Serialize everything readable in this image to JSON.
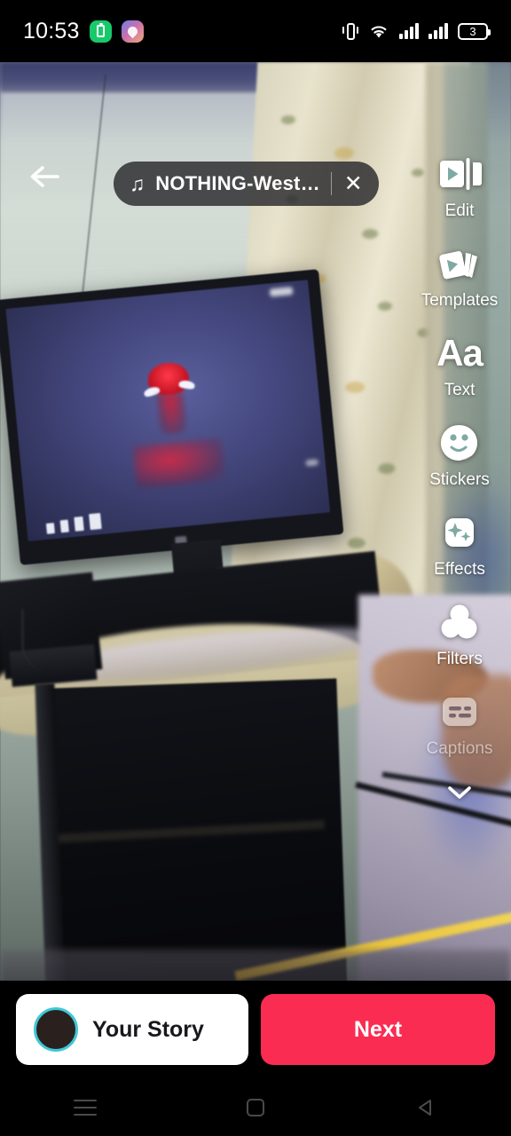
{
  "statusbar": {
    "time": "10:53",
    "battery_level": "3",
    "icons": [
      "battery-saver-icon",
      "app-icon",
      "gmail-icon",
      "vibrate-icon",
      "wifi-icon",
      "signal-icon",
      "signal-icon",
      "battery-icon"
    ]
  },
  "overlay": {
    "back_label": "←",
    "music": {
      "note_icon": "♫",
      "title": "NOTHING-West…",
      "close_label": "✕"
    }
  },
  "tools": [
    {
      "label": "Edit",
      "icon": "edit-icon",
      "enabled": true
    },
    {
      "label": "Templates",
      "icon": "templates-icon",
      "enabled": true
    },
    {
      "label": "Text",
      "icon": "text-icon",
      "enabled": true,
      "glyph": "Aa"
    },
    {
      "label": "Stickers",
      "icon": "stickers-icon",
      "enabled": true
    },
    {
      "label": "Effects",
      "icon": "effects-icon",
      "enabled": true
    },
    {
      "label": "Filters",
      "icon": "filters-icon",
      "enabled": true
    },
    {
      "label": "Captions",
      "icon": "captions-icon",
      "enabled": false
    }
  ],
  "expand": {
    "icon": "chevron-down-icon"
  },
  "bottom": {
    "story_label": "Your Story",
    "next_label": "Next",
    "avatar_ring_color": "#3fc8d6",
    "next_color": "#fa2c52"
  },
  "navbar": {
    "recents": "recents-icon",
    "home": "home-icon",
    "back": "back-icon"
  },
  "photo": {
    "description": "Blurry indoor photo of a desktop monitor on a dark wooden desk, red Spider-Man wallpaper on screen, patterned cream curtain and pale green wall behind, yellow cable on floor"
  }
}
